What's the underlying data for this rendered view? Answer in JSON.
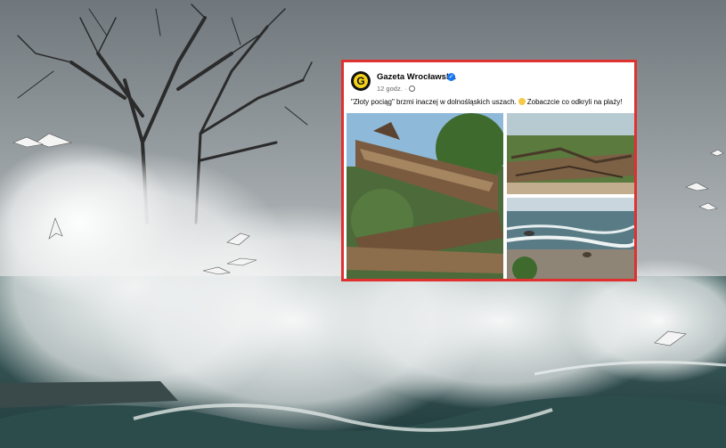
{
  "post": {
    "page_name": "Gazeta Wrocławska",
    "verified_icon": "verified-badge-icon",
    "time": "12 godz.",
    "separator": "·",
    "text_before_emoji": "\"Złoty pociąg\" brzmi inaczej w dolnośląskich uszach.",
    "text_after_emoji": "Zobaczcie co odkryli na plaży!",
    "avatar_letter": "G",
    "frame_color": "#e03131",
    "brand_color": "#f2d21b"
  },
  "photos": [
    {
      "label": "driftwood-closeup"
    },
    {
      "label": "driftwood-pile"
    },
    {
      "label": "beach-waves"
    }
  ]
}
